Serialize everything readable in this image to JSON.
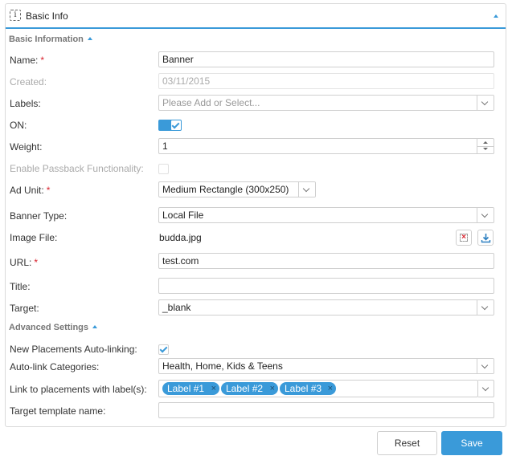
{
  "panel": {
    "title": "Basic Info"
  },
  "sections": {
    "basic": "Basic Information",
    "advanced": "Advanced Settings"
  },
  "fields": {
    "name": {
      "label": "Name:",
      "value": "Banner",
      "required": "*"
    },
    "created": {
      "label": "Created:",
      "value": "03/11/2015"
    },
    "labels": {
      "label": "Labels:",
      "placeholder": "Please Add or Select..."
    },
    "on": {
      "label": "ON:",
      "checked": true
    },
    "weight": {
      "label": "Weight:",
      "value": "1"
    },
    "passback": {
      "label": "Enable Passback Functionality:",
      "checked": false
    },
    "ad_unit": {
      "label": "Ad Unit:",
      "value": "Medium Rectangle (300x250)",
      "required": "*"
    },
    "banner_type": {
      "label": "Banner Type:",
      "value": "Local File"
    },
    "image_file": {
      "label": "Image File:",
      "value": "budda.jpg"
    },
    "url": {
      "label": "URL:",
      "value": "test.com",
      "required": "*"
    },
    "title": {
      "label": "Title:",
      "value": ""
    },
    "target": {
      "label": "Target:",
      "value": "_blank"
    },
    "auto_linking": {
      "label": "New Placements Auto-linking:",
      "checked": true
    },
    "auto_link_categories": {
      "label": "Auto-link Categories:",
      "value": "Health, Home, Kids & Teens"
    },
    "link_labels": {
      "label": "Link to placements with label(s):",
      "tags": [
        "Label #1",
        "Label #2",
        "Label #3"
      ],
      "remove_glyph": "×"
    },
    "target_template": {
      "label": "Target template name:",
      "value": ""
    }
  },
  "buttons": {
    "reset": "Reset",
    "save": "Save"
  },
  "icons": {
    "panel": "info-icon",
    "clear": "clear-file-icon",
    "download": "download-icon"
  },
  "colors": {
    "accent": "#3a9ad9",
    "required": "#d9232e"
  }
}
